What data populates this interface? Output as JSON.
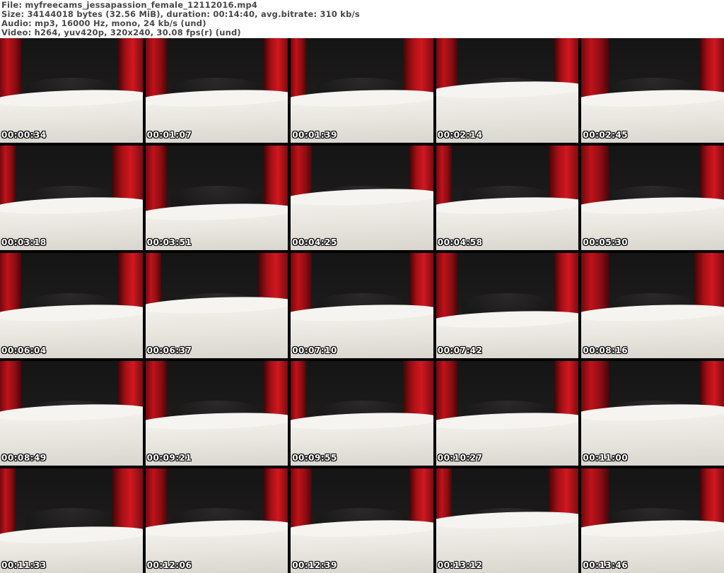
{
  "header": {
    "lines": [
      "File: myfreecams_jessapassion_female_12112016.mp4",
      "Size: 34144018 bytes (32.56 MiB), duration: 00:14:40, avg.bitrate: 310 kb/s",
      "Audio: mp3, 16000 Hz, mono, 24 kb/s (und)",
      "Video: h264, yuv420p, 320x240, 30.08 fps(r) (und)"
    ]
  },
  "grid": {
    "rows": 5,
    "cols": 5,
    "thumbnails": [
      {
        "timestamp": "00:00:34"
      },
      {
        "timestamp": "00:01:07"
      },
      {
        "timestamp": "00:01:39"
      },
      {
        "timestamp": "00:02:14"
      },
      {
        "timestamp": "00:02:45"
      },
      {
        "timestamp": "00:03:18"
      },
      {
        "timestamp": "00:03:51"
      },
      {
        "timestamp": "00:04:25"
      },
      {
        "timestamp": "00:04:58"
      },
      {
        "timestamp": "00:05:30"
      },
      {
        "timestamp": "00:06:04"
      },
      {
        "timestamp": "00:06:37"
      },
      {
        "timestamp": "00:07:10"
      },
      {
        "timestamp": "00:07:42"
      },
      {
        "timestamp": "00:08:16"
      },
      {
        "timestamp": "00:08:49"
      },
      {
        "timestamp": "00:09:21"
      },
      {
        "timestamp": "00:09:55"
      },
      {
        "timestamp": "00:10:27"
      },
      {
        "timestamp": "00:11:00"
      },
      {
        "timestamp": "00:11:33"
      },
      {
        "timestamp": "00:12:06"
      },
      {
        "timestamp": "00:12:39"
      },
      {
        "timestamp": "00:13:12"
      },
      {
        "timestamp": "00:13:46"
      }
    ]
  },
  "colors": {
    "header_bg": "#ffffff",
    "header_text": "#474747",
    "grid_bg": "#000000",
    "curtain_red": "#c01219",
    "bed_white": "#e9e6e0",
    "timestamp_text": "#ffffff"
  }
}
